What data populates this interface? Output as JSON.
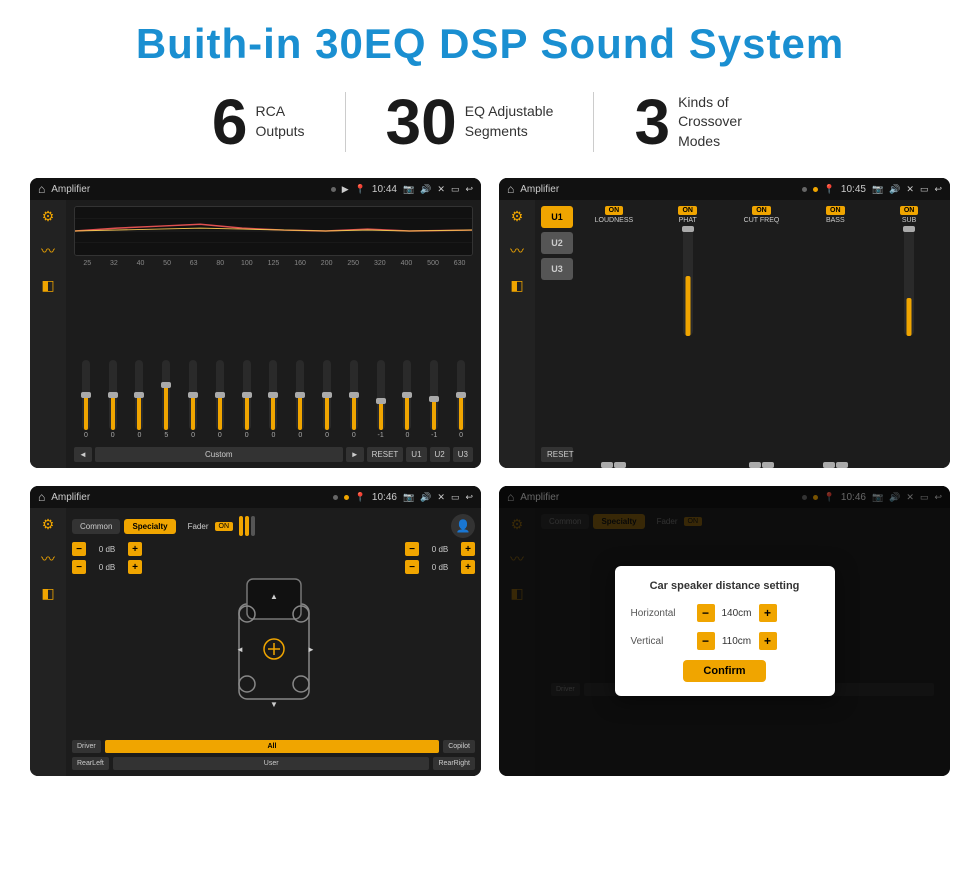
{
  "title": "Buith-in 30EQ DSP Sound System",
  "stats": [
    {
      "number": "6",
      "label": "RCA\nOutputs"
    },
    {
      "number": "30",
      "label": "EQ Adjustable\nSegments"
    },
    {
      "number": "3",
      "label": "Kinds of\nCrossover Modes"
    }
  ],
  "screens": [
    {
      "id": "eq-screen",
      "status_bar": {
        "title": "Amplifier",
        "time": "10:44"
      },
      "type": "equalizer"
    },
    {
      "id": "crossover-screen",
      "status_bar": {
        "title": "Amplifier",
        "time": "10:45"
      },
      "type": "crossover"
    },
    {
      "id": "speaker-screen",
      "status_bar": {
        "title": "Amplifier",
        "time": "10:46"
      },
      "type": "speaker"
    },
    {
      "id": "distance-screen",
      "status_bar": {
        "title": "Amplifier",
        "time": "10:46"
      },
      "type": "distance",
      "dialog": {
        "title": "Car speaker distance setting",
        "horizontal_label": "Horizontal",
        "horizontal_value": "140cm",
        "vertical_label": "Vertical",
        "vertical_value": "110cm",
        "confirm_label": "Confirm"
      }
    }
  ],
  "eq": {
    "frequencies": [
      "25",
      "32",
      "40",
      "50",
      "63",
      "80",
      "100",
      "125",
      "160",
      "200",
      "250",
      "320",
      "400",
      "500",
      "630"
    ],
    "values": [
      "0",
      "0",
      "0",
      "5",
      "0",
      "0",
      "0",
      "0",
      "0",
      "0",
      "0",
      "-1",
      "0",
      "-1"
    ],
    "slider_heights": [
      50,
      50,
      50,
      65,
      50,
      50,
      50,
      50,
      50,
      50,
      50,
      42,
      50,
      45,
      50
    ],
    "controls": {
      "prev": "◄",
      "label": "Custom",
      "next": "►",
      "reset": "RESET",
      "u1": "U1",
      "u2": "U2",
      "u3": "U3"
    }
  },
  "crossover": {
    "users": [
      "U1",
      "U2",
      "U3"
    ],
    "channels": [
      {
        "name": "LOUDNESS",
        "on": true
      },
      {
        "name": "PHAT",
        "on": true
      },
      {
        "name": "CUT FREQ",
        "on": true
      },
      {
        "name": "BASS",
        "on": true
      },
      {
        "name": "SUB",
        "on": true
      }
    ],
    "reset": "RESET"
  },
  "speaker": {
    "tabs": [
      "Common",
      "Specialty"
    ],
    "active_tab": "Specialty",
    "fader_label": "Fader",
    "fader_on": "ON",
    "db_values": [
      "0 dB",
      "0 dB",
      "0 dB",
      "0 dB"
    ],
    "buttons": {
      "driver": "Driver",
      "copilot": "Copilot",
      "rear_left": "RearLeft",
      "all": "All",
      "user": "User",
      "rear_right": "RearRight"
    }
  }
}
